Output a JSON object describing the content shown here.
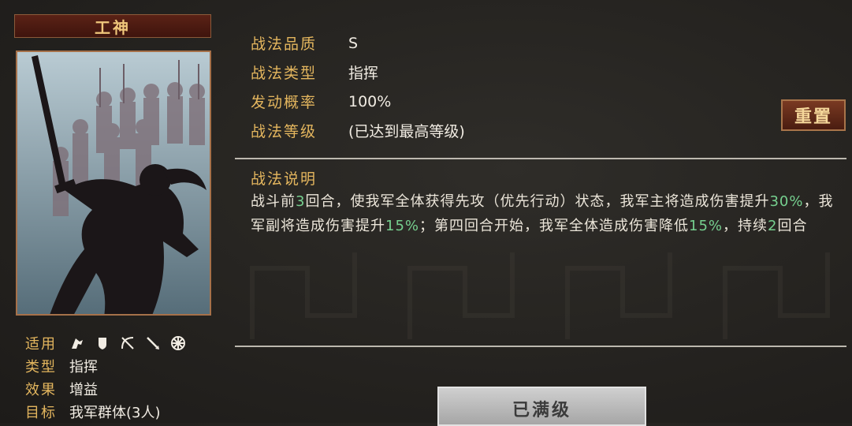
{
  "card": {
    "title": "工神"
  },
  "info": {
    "applicable_label": "适用",
    "troop_icons": [
      "cavalry-icon",
      "shield-icon",
      "bow-icon",
      "spear-icon",
      "wheel-icon"
    ],
    "type_label": "类型",
    "type_value": "指挥",
    "effect_label": "效果",
    "effect_value": "增益",
    "target_label": "目标",
    "target_value": "我军群体(3人)"
  },
  "attrs": [
    {
      "key": "战法品质",
      "value": "S"
    },
    {
      "key": "战法类型",
      "value": "指挥"
    },
    {
      "key": "发动概率",
      "value": "100%"
    },
    {
      "key": "战法等级",
      "value": "(已达到最高等级)"
    }
  ],
  "reset_label": "重置",
  "description": {
    "title": "战法说明",
    "segments": [
      {
        "t": "战斗前",
        "h": false
      },
      {
        "t": "3",
        "h": true
      },
      {
        "t": "回合，使我军全体获得先攻（优先行动）状态，我军主将造成伤害提升",
        "h": false
      },
      {
        "t": "30%",
        "h": true
      },
      {
        "t": "，我军副将造成伤害提升",
        "h": false
      },
      {
        "t": "15%",
        "h": true
      },
      {
        "t": "；第四回合开始，我军全体造成伤害降低",
        "h": false
      },
      {
        "t": "15%",
        "h": true
      },
      {
        "t": "，持续",
        "h": false
      },
      {
        "t": "2",
        "h": true
      },
      {
        "t": "回合",
        "h": false
      }
    ]
  },
  "maxed_label": "已满级",
  "colors": {
    "accent_gold": "#e4b65e",
    "highlight_green": "#76d08f",
    "title_red": "#5b2216"
  }
}
